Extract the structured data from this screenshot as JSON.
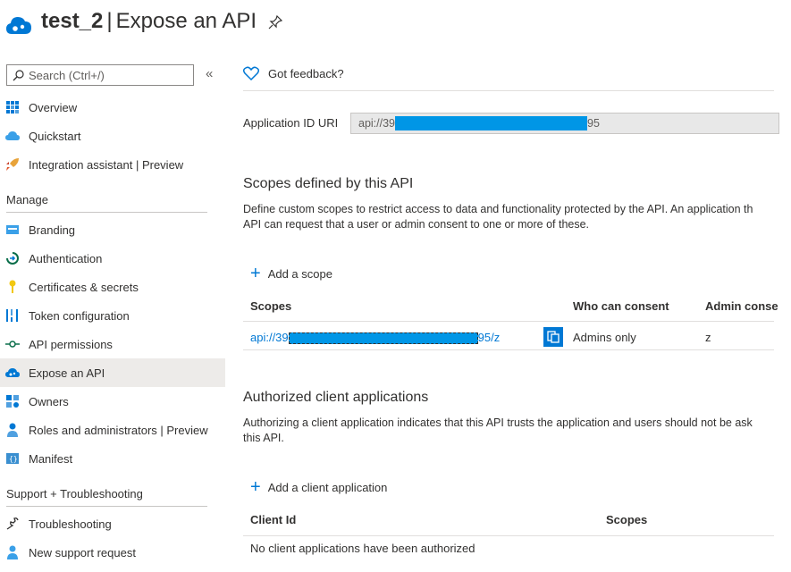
{
  "header": {
    "app_name": "test_2",
    "separator": "|",
    "page_title": "Expose an API"
  },
  "sidebar": {
    "search_placeholder": "Search (Ctrl+/)",
    "collapse_glyph": "«",
    "items_top": [
      {
        "label": "Overview",
        "icon": "grid-icon"
      },
      {
        "label": "Quickstart",
        "icon": "cloud-icon"
      },
      {
        "label": "Integration assistant | Preview",
        "icon": "rocket-icon"
      }
    ],
    "manage_label": "Manage",
    "items_manage": [
      {
        "label": "Branding",
        "icon": "branding-icon"
      },
      {
        "label": "Authentication",
        "icon": "authentication-icon"
      },
      {
        "label": "Certificates & secrets",
        "icon": "key-icon"
      },
      {
        "label": "Token configuration",
        "icon": "token-icon"
      },
      {
        "label": "API permissions",
        "icon": "permissions-icon"
      },
      {
        "label": "Expose an API",
        "icon": "cloud-gear-icon",
        "active": true
      },
      {
        "label": "Owners",
        "icon": "owners-icon"
      },
      {
        "label": "Roles and administrators | Preview",
        "icon": "roles-icon"
      },
      {
        "label": "Manifest",
        "icon": "manifest-icon"
      }
    ],
    "support_label": "Support + Troubleshooting",
    "items_support": [
      {
        "label": "Troubleshooting",
        "icon": "wrench-icon"
      },
      {
        "label": "New support request",
        "icon": "support-person-icon"
      }
    ]
  },
  "main": {
    "feedback_label": "Got feedback?",
    "app_id_label": "Application ID URI",
    "app_id_prefix": "api://39",
    "app_id_suffix": "95",
    "scopes_heading": "Scopes defined by this API",
    "scopes_desc_line1": "Define custom scopes to restrict access to data and functionality protected by the API. An application th",
    "scopes_desc_line2": "API can request that a user or admin consent to one or more of these.",
    "add_scope_label": "Add a scope",
    "scopes_table": {
      "headers": [
        "Scopes",
        "Who can consent",
        "Admin conse"
      ],
      "rows": [
        {
          "scope_prefix": "api://39",
          "scope_suffix": "95/z",
          "who": "Admins only",
          "admin": "z"
        }
      ]
    },
    "auth_heading": "Authorized client applications",
    "auth_desc_line1": "Authorizing a client application indicates that this API trusts the application and users should not be ask",
    "auth_desc_line2": "this API.",
    "add_client_label": "Add a client application",
    "clients_table": {
      "headers": [
        "Client Id",
        "Scopes"
      ],
      "empty_text": "No client applications have been authorized"
    }
  },
  "colors": {
    "accent": "#0078d4",
    "redaction": "#0096e6",
    "active_bg": "#edebe9"
  }
}
